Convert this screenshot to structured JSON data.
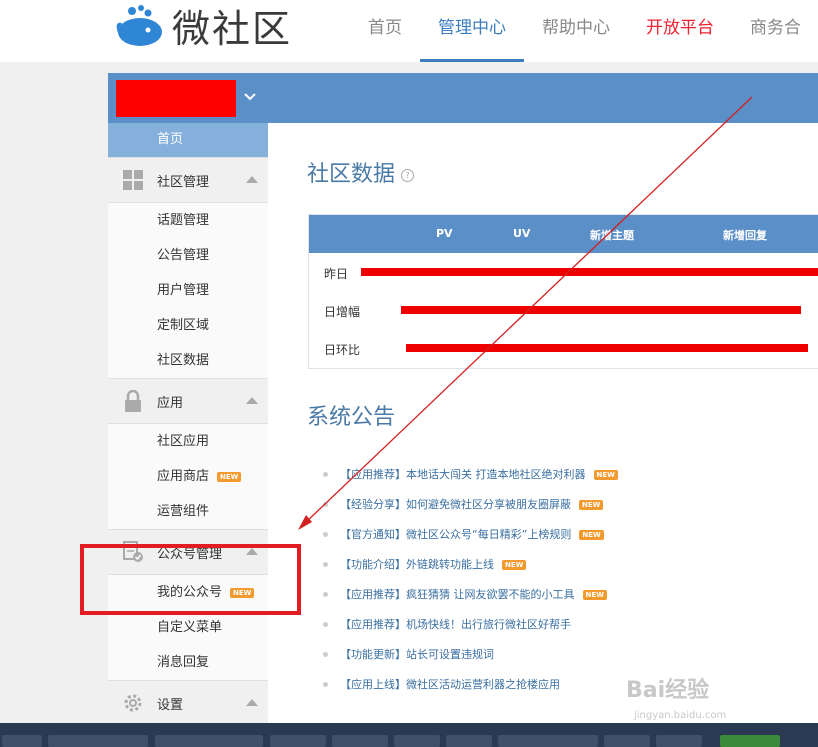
{
  "brand": {
    "name": "微社区",
    "colors": {
      "accent": "#3c7fc0",
      "header_bar": "#5b8fc7",
      "hot": "#e22233",
      "badge": "#f39a2f",
      "highlight_box": "#e31b23"
    }
  },
  "nav": {
    "items": [
      {
        "label": "首页"
      },
      {
        "label": "管理中心"
      },
      {
        "label": "帮助中心"
      },
      {
        "label": "开放平台"
      },
      {
        "label": "商务合"
      }
    ]
  },
  "sidebar": {
    "home": "首页",
    "community": {
      "title": "社区管理",
      "icon": "grid-icon",
      "items": [
        "话题管理",
        "公告管理",
        "用户管理",
        "定制区域",
        "社区数据"
      ]
    },
    "apps": {
      "title": "应用",
      "icon": "lock-icon",
      "items": [
        {
          "label": "社区应用",
          "is_new": false
        },
        {
          "label": "应用商店",
          "is_new": true
        },
        {
          "label": "运营组件",
          "is_new": false
        }
      ]
    },
    "public": {
      "title": "公众号管理",
      "icon": "document-check-icon",
      "items": [
        {
          "label": "我的公众号",
          "is_new": true
        },
        {
          "label": "自定义菜单",
          "is_new": false
        },
        {
          "label": "消息回复",
          "is_new": false
        }
      ]
    },
    "settings": {
      "title": "设置",
      "icon": "gear-icon"
    },
    "new_badge": "NEW"
  },
  "stats": {
    "title": "社区数据",
    "help_icon": "?",
    "columns": [
      "PV",
      "UV",
      "新增主题",
      "新增回复"
    ],
    "rows": [
      "昨日",
      "日增幅",
      "日环比"
    ]
  },
  "announcements": {
    "title": "系统公告",
    "items": [
      {
        "text": "【应用推荐】本地话大闯关 打造本地社区绝对利器",
        "is_new": true
      },
      {
        "text": "【经验分享】如何避免微社区分享被朋友圈屏蔽",
        "is_new": true
      },
      {
        "text": "【官方通知】微社区公众号“每日精彩”上榜规则",
        "is_new": true
      },
      {
        "text": "【功能介绍】外链跳转功能上线",
        "is_new": true
      },
      {
        "text": "【应用推荐】疯狂猜猜 让网友欲罢不能的小工具",
        "is_new": true
      },
      {
        "text": "【应用推荐】机场快线！出行旅行微社区好帮手",
        "is_new": false
      },
      {
        "text": "【功能更新】站长可设置违规词",
        "is_new": false
      },
      {
        "text": "【应用上线】微社区活动运营利器之抢楼应用",
        "is_new": false
      }
    ]
  },
  "watermark": {
    "brand": "Bai经验",
    "url": "jingyan.baidu.com"
  }
}
